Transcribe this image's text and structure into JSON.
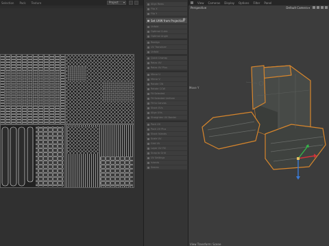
{
  "uv_editor": {
    "menu": [
      "Selection",
      "Pack",
      "Texture"
    ],
    "mode_select": "Project"
  },
  "tools": {
    "project_label": "Set UVW from Projection",
    "rows_group1": [
      "Align Rows",
      "Flip X",
      "Flip Y"
    ],
    "rows_group2": [
      "Unfold",
      "Optimal Cubic",
      "Optimal Angle",
      "Realign",
      "UV Transform"
    ],
    "rows_group3": [
      "Unfold",
      "Quick Unwrap",
      "Relax UV",
      "Relax UV Plus"
    ],
    "rows_group4": [
      "Mirror U",
      "Mirror V",
      "Rotate CW",
      "Rotate CCW",
      "Fit Selected",
      "Fit Selected Uniform",
      "Fit to Canvas",
      "Stack UVs",
      "Align UVs",
      "Straighten UV Border"
    ],
    "rows_group5": [
      "Pack UV",
      "Pack UV Plus",
      "Stack Islands",
      "Scale UV",
      "Grid UV",
      "Layer UV Fill",
      "Snap to Grid",
      "UV Settings",
      "Islands",
      "Seams"
    ]
  },
  "viewport": {
    "menu": [
      "View",
      "Cameras",
      "Display",
      "Options",
      "Filter",
      "Panel"
    ],
    "perspective": "Perspective",
    "camera": "Default Camera",
    "axis_label": "Move Y",
    "status": "View Transform: Scene"
  },
  "colors": {
    "selection_outline": "#d8862c",
    "axis_x": "#d0323a",
    "axis_y": "#34b84a",
    "axis_z": "#3a7bd8"
  }
}
